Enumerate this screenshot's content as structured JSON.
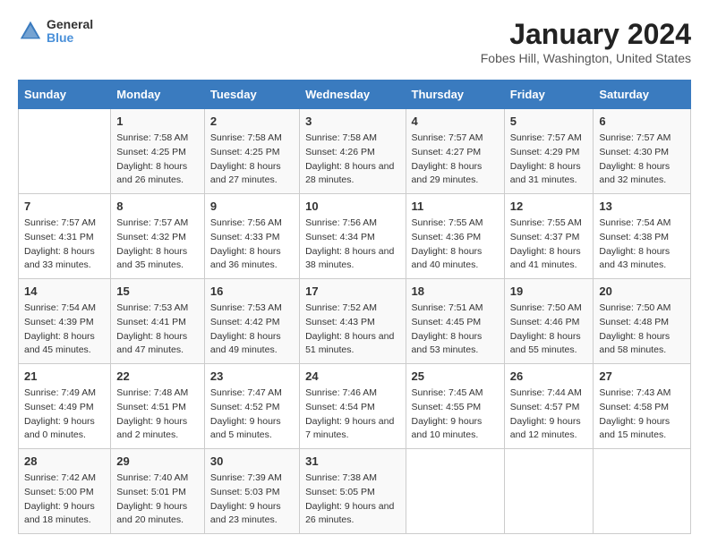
{
  "header": {
    "logo_general": "General",
    "logo_blue": "Blue",
    "title": "January 2024",
    "subtitle": "Fobes Hill, Washington, United States"
  },
  "columns": [
    "Sunday",
    "Monday",
    "Tuesday",
    "Wednesday",
    "Thursday",
    "Friday",
    "Saturday"
  ],
  "weeks": [
    [
      {
        "day": "",
        "sunrise": "",
        "sunset": "",
        "daylight": ""
      },
      {
        "day": "1",
        "sunrise": "Sunrise: 7:58 AM",
        "sunset": "Sunset: 4:25 PM",
        "daylight": "Daylight: 8 hours and 26 minutes."
      },
      {
        "day": "2",
        "sunrise": "Sunrise: 7:58 AM",
        "sunset": "Sunset: 4:25 PM",
        "daylight": "Daylight: 8 hours and 27 minutes."
      },
      {
        "day": "3",
        "sunrise": "Sunrise: 7:58 AM",
        "sunset": "Sunset: 4:26 PM",
        "daylight": "Daylight: 8 hours and 28 minutes."
      },
      {
        "day": "4",
        "sunrise": "Sunrise: 7:57 AM",
        "sunset": "Sunset: 4:27 PM",
        "daylight": "Daylight: 8 hours and 29 minutes."
      },
      {
        "day": "5",
        "sunrise": "Sunrise: 7:57 AM",
        "sunset": "Sunset: 4:29 PM",
        "daylight": "Daylight: 8 hours and 31 minutes."
      },
      {
        "day": "6",
        "sunrise": "Sunrise: 7:57 AM",
        "sunset": "Sunset: 4:30 PM",
        "daylight": "Daylight: 8 hours and 32 minutes."
      }
    ],
    [
      {
        "day": "7",
        "sunrise": "Sunrise: 7:57 AM",
        "sunset": "Sunset: 4:31 PM",
        "daylight": "Daylight: 8 hours and 33 minutes."
      },
      {
        "day": "8",
        "sunrise": "Sunrise: 7:57 AM",
        "sunset": "Sunset: 4:32 PM",
        "daylight": "Daylight: 8 hours and 35 minutes."
      },
      {
        "day": "9",
        "sunrise": "Sunrise: 7:56 AM",
        "sunset": "Sunset: 4:33 PM",
        "daylight": "Daylight: 8 hours and 36 minutes."
      },
      {
        "day": "10",
        "sunrise": "Sunrise: 7:56 AM",
        "sunset": "Sunset: 4:34 PM",
        "daylight": "Daylight: 8 hours and 38 minutes."
      },
      {
        "day": "11",
        "sunrise": "Sunrise: 7:55 AM",
        "sunset": "Sunset: 4:36 PM",
        "daylight": "Daylight: 8 hours and 40 minutes."
      },
      {
        "day": "12",
        "sunrise": "Sunrise: 7:55 AM",
        "sunset": "Sunset: 4:37 PM",
        "daylight": "Daylight: 8 hours and 41 minutes."
      },
      {
        "day": "13",
        "sunrise": "Sunrise: 7:54 AM",
        "sunset": "Sunset: 4:38 PM",
        "daylight": "Daylight: 8 hours and 43 minutes."
      }
    ],
    [
      {
        "day": "14",
        "sunrise": "Sunrise: 7:54 AM",
        "sunset": "Sunset: 4:39 PM",
        "daylight": "Daylight: 8 hours and 45 minutes."
      },
      {
        "day": "15",
        "sunrise": "Sunrise: 7:53 AM",
        "sunset": "Sunset: 4:41 PM",
        "daylight": "Daylight: 8 hours and 47 minutes."
      },
      {
        "day": "16",
        "sunrise": "Sunrise: 7:53 AM",
        "sunset": "Sunset: 4:42 PM",
        "daylight": "Daylight: 8 hours and 49 minutes."
      },
      {
        "day": "17",
        "sunrise": "Sunrise: 7:52 AM",
        "sunset": "Sunset: 4:43 PM",
        "daylight": "Daylight: 8 hours and 51 minutes."
      },
      {
        "day": "18",
        "sunrise": "Sunrise: 7:51 AM",
        "sunset": "Sunset: 4:45 PM",
        "daylight": "Daylight: 8 hours and 53 minutes."
      },
      {
        "day": "19",
        "sunrise": "Sunrise: 7:50 AM",
        "sunset": "Sunset: 4:46 PM",
        "daylight": "Daylight: 8 hours and 55 minutes."
      },
      {
        "day": "20",
        "sunrise": "Sunrise: 7:50 AM",
        "sunset": "Sunset: 4:48 PM",
        "daylight": "Daylight: 8 hours and 58 minutes."
      }
    ],
    [
      {
        "day": "21",
        "sunrise": "Sunrise: 7:49 AM",
        "sunset": "Sunset: 4:49 PM",
        "daylight": "Daylight: 9 hours and 0 minutes."
      },
      {
        "day": "22",
        "sunrise": "Sunrise: 7:48 AM",
        "sunset": "Sunset: 4:51 PM",
        "daylight": "Daylight: 9 hours and 2 minutes."
      },
      {
        "day": "23",
        "sunrise": "Sunrise: 7:47 AM",
        "sunset": "Sunset: 4:52 PM",
        "daylight": "Daylight: 9 hours and 5 minutes."
      },
      {
        "day": "24",
        "sunrise": "Sunrise: 7:46 AM",
        "sunset": "Sunset: 4:54 PM",
        "daylight": "Daylight: 9 hours and 7 minutes."
      },
      {
        "day": "25",
        "sunrise": "Sunrise: 7:45 AM",
        "sunset": "Sunset: 4:55 PM",
        "daylight": "Daylight: 9 hours and 10 minutes."
      },
      {
        "day": "26",
        "sunrise": "Sunrise: 7:44 AM",
        "sunset": "Sunset: 4:57 PM",
        "daylight": "Daylight: 9 hours and 12 minutes."
      },
      {
        "day": "27",
        "sunrise": "Sunrise: 7:43 AM",
        "sunset": "Sunset: 4:58 PM",
        "daylight": "Daylight: 9 hours and 15 minutes."
      }
    ],
    [
      {
        "day": "28",
        "sunrise": "Sunrise: 7:42 AM",
        "sunset": "Sunset: 5:00 PM",
        "daylight": "Daylight: 9 hours and 18 minutes."
      },
      {
        "day": "29",
        "sunrise": "Sunrise: 7:40 AM",
        "sunset": "Sunset: 5:01 PM",
        "daylight": "Daylight: 9 hours and 20 minutes."
      },
      {
        "day": "30",
        "sunrise": "Sunrise: 7:39 AM",
        "sunset": "Sunset: 5:03 PM",
        "daylight": "Daylight: 9 hours and 23 minutes."
      },
      {
        "day": "31",
        "sunrise": "Sunrise: 7:38 AM",
        "sunset": "Sunset: 5:05 PM",
        "daylight": "Daylight: 9 hours and 26 minutes."
      },
      {
        "day": "",
        "sunrise": "",
        "sunset": "",
        "daylight": ""
      },
      {
        "day": "",
        "sunrise": "",
        "sunset": "",
        "daylight": ""
      },
      {
        "day": "",
        "sunrise": "",
        "sunset": "",
        "daylight": ""
      }
    ]
  ]
}
